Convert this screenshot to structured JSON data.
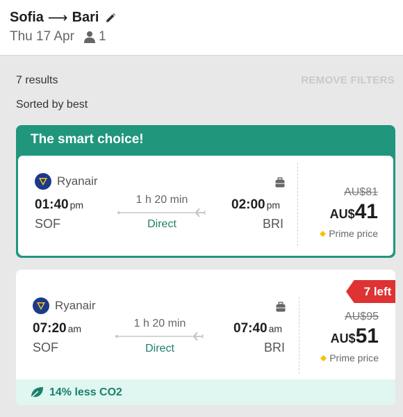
{
  "header": {
    "origin": "Sofia",
    "arrow": "⟶",
    "destination": "Bari",
    "date": "Thu 17 Apr",
    "passengers": "1"
  },
  "results": {
    "count": "7 results",
    "remove_filters": "REMOVE FILTERS",
    "sorted": "Sorted by best"
  },
  "smart_choice": {
    "title": "The smart choice!",
    "airline": "Ryanair",
    "dep_time": "01:40",
    "dep_ampm": "pm",
    "dep_code": "SOF",
    "duration": "1 h 20 min",
    "stops": "Direct",
    "arr_time": "02:00",
    "arr_ampm": "pm",
    "arr_code": "BRI",
    "old_price": "AU$81",
    "currency": "AU$",
    "price": "41",
    "prime_label": "Prime price"
  },
  "flight2": {
    "badge": "7 left",
    "airline": "Ryanair",
    "dep_time": "07:20",
    "dep_ampm": "am",
    "dep_code": "SOF",
    "duration": "1 h 20 min",
    "stops": "Direct",
    "arr_time": "07:40",
    "arr_ampm": "am",
    "arr_code": "BRI",
    "old_price": "AU$95",
    "currency": "AU$",
    "price": "51",
    "prime_label": "Prime price",
    "co2": "14% less CO2"
  },
  "colors": {
    "accent": "#20967d",
    "accent_text": "#1c7f6a",
    "badge": "#dd3333",
    "prime_diamond": "#f2c400"
  },
  "icons": [
    "edit-icon",
    "person-icon",
    "ryanair-logo-icon",
    "plane-icon",
    "luggage-icon",
    "diamond-icon",
    "leaf-icon"
  ]
}
